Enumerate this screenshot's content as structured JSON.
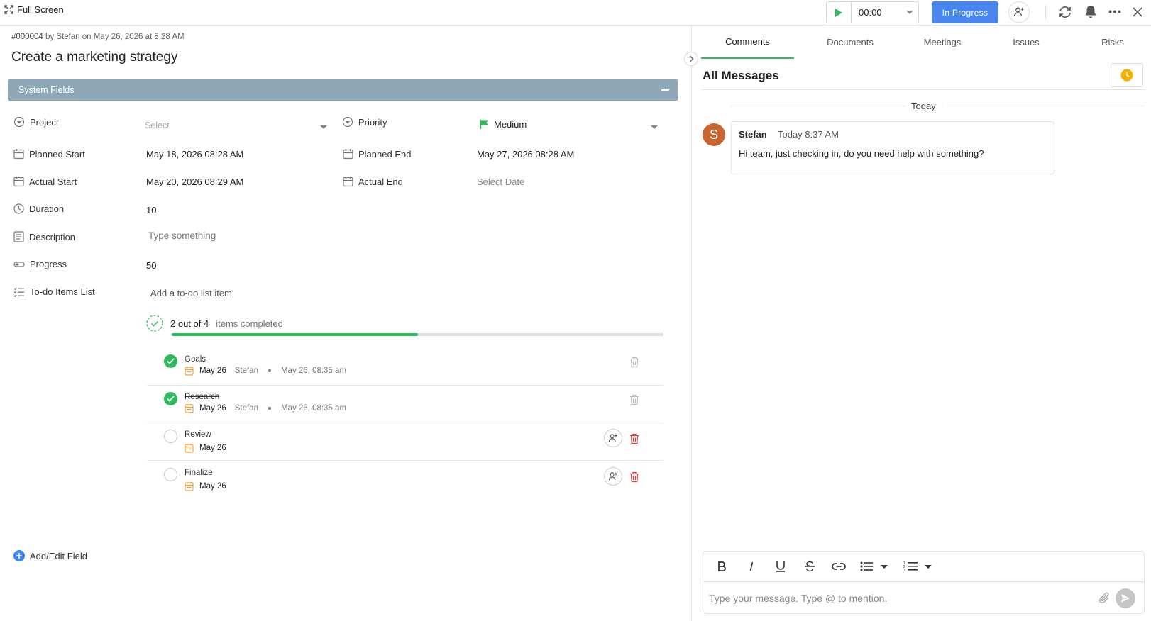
{
  "topbar": {
    "fullscreen_label": "Full Screen",
    "timer": "00:00",
    "status": "In Progress"
  },
  "task": {
    "meta_id": "#000004",
    "meta_rest": "by Stefan on May 26, 2026 at 8:28 AM",
    "title": "Create a marketing strategy",
    "section_label": "System Fields"
  },
  "fields": {
    "project_label": "Project",
    "project_placeholder": "Select",
    "priority_label": "Priority",
    "priority_value": "Medium",
    "planned_start_label": "Planned Start",
    "planned_start_value": "May 18, 2026 08:28 AM",
    "planned_end_label": "Planned End",
    "planned_end_value": "May 27, 2026 08:28 AM",
    "actual_start_label": "Actual Start",
    "actual_start_value": "May 20, 2026 08:29 AM",
    "actual_end_label": "Actual End",
    "actual_end_placeholder": "Select Date",
    "duration_label": "Duration",
    "duration_value": "10",
    "description_label": "Description",
    "description_placeholder": "Type something",
    "progress_label": "Progress",
    "progress_value": "50",
    "todo_label": "To-do Items List",
    "todo_add_placeholder": "Add a to-do list item"
  },
  "todo": {
    "count_text": "2 out of 4",
    "suffix_text": "items completed",
    "progress_fraction": 0.5,
    "items": [
      {
        "name": "Goals",
        "date": "May 26",
        "by": "Stefan",
        "completed_at": "May 26, 08:35 am"
      },
      {
        "name": "Research",
        "date": "May 26",
        "by": "Stefan",
        "completed_at": "May 26, 08:35 am"
      },
      {
        "name": "Review",
        "date": "May 26"
      },
      {
        "name": "Finalize",
        "date": "May 26"
      }
    ]
  },
  "add_field_label": "Add/Edit Field",
  "tabs": [
    "Comments",
    "Documents",
    "Meetings",
    "Issues",
    "Risks"
  ],
  "messages": {
    "header": "All Messages",
    "day_divider": "Today",
    "items": [
      {
        "avatar": "S",
        "author": "Stefan",
        "time": "Today 8:37 AM",
        "text": "Hi team, just checking in, do you need help with something?"
      }
    ]
  },
  "composer": {
    "placeholder": "Type your message. Type @ to mention."
  },
  "colors": {
    "accent_green": "#2fba5e",
    "status_blue": "#4a86f0",
    "section_bar": "#8ea8b8",
    "avatar": "#c8642e",
    "delete_red": "#e0403a",
    "calendar_orange": "#f0a040",
    "clock_yellow": "#f5b000"
  }
}
